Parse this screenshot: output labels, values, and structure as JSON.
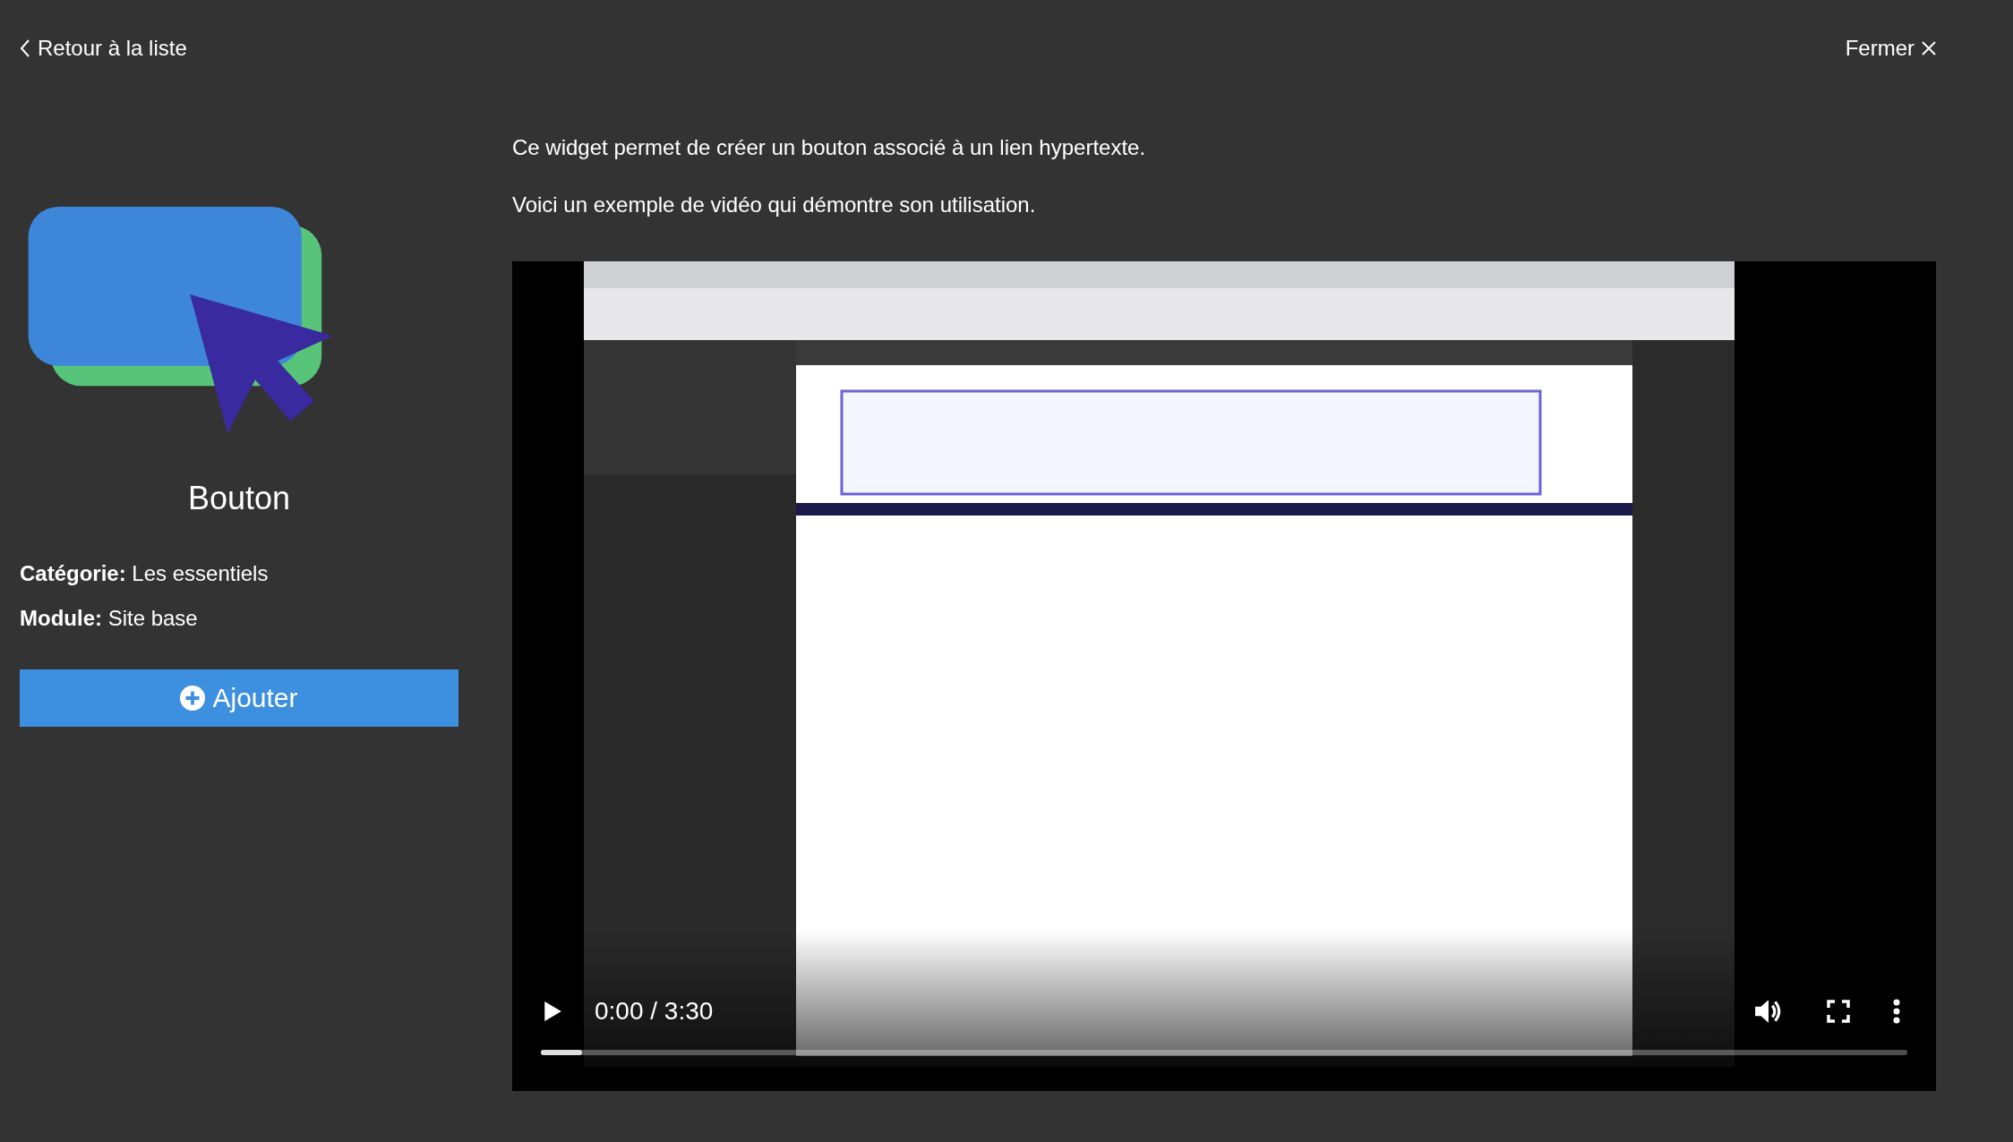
{
  "header": {
    "back_link": "Retour à la liste",
    "close_link": "Fermer"
  },
  "widget": {
    "name": "Bouton",
    "meta": [
      {
        "label": "Catégorie:",
        "value": "Les essentiels"
      },
      {
        "label": "Module:",
        "value": "Site base"
      }
    ],
    "add_button": "Ajouter"
  },
  "description": [
    "Ce widget permet de créer un bouton associé à un lien hypertexte.",
    "Voici un exemple de vidéo qui démontre son utilisation."
  ],
  "video": {
    "kind": "picture",
    "time": "0:00 / 3:30",
    "progress": {
      "level": 0.03
    }
  }
}
